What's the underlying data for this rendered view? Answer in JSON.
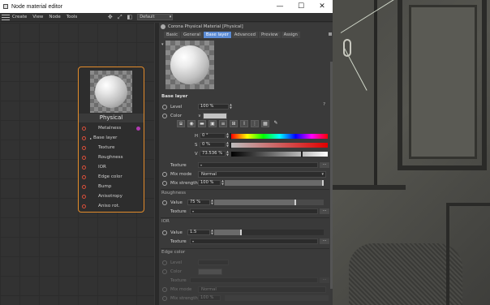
{
  "window": {
    "title": "Node material editor",
    "minimize_glyph": "—",
    "maximize_glyph": "☐",
    "close_glyph": "✕"
  },
  "menubar": {
    "items": [
      "Create",
      "View",
      "Node",
      "Tools"
    ],
    "layout_value": "Default",
    "tool_icons": [
      "move-icon",
      "fit-icon",
      "split-view-icon"
    ]
  },
  "node": {
    "title": "Physical",
    "ports": [
      {
        "label": "Metalness",
        "indent": false,
        "output": true
      },
      {
        "label": "Base layer",
        "indent": false,
        "expander": true
      },
      {
        "label": "Texture",
        "indent": true
      },
      {
        "label": "Roughness",
        "indent": true
      },
      {
        "label": "IOR",
        "indent": true
      },
      {
        "label": "Edge color",
        "indent": true
      },
      {
        "label": "Bump",
        "indent": true
      },
      {
        "label": "Anisotropy",
        "indent": true
      },
      {
        "label": "Aniso rot.",
        "indent": true
      }
    ],
    "accent_color": "#e28b2a",
    "port_color": "#d94f3b",
    "output_port_color": "#b03bb0"
  },
  "attributes": {
    "header": "Corona Physical Material [Physical]",
    "tabs": [
      "Basic",
      "General",
      "Base layer",
      "Advanced",
      "Preview",
      "Assign"
    ],
    "active_tab": "Base layer",
    "active_tab_color": "#5b8bd4",
    "base_layer": {
      "section": "Base layer",
      "help": "?",
      "level_label": "Level",
      "level_value": "100 %",
      "color_label": "Color",
      "color_value": "#c4c4c4",
      "color_icons": [
        "eyedropper-square-icon",
        "color-wheel-icon",
        "spectrum-icon",
        "image-icon",
        "rgb-icon",
        "hsv-icon",
        "kelvin-icon",
        "mixer-icon",
        "swatches-icon",
        "eyedropper-icon"
      ],
      "hsv": {
        "h_label": "H",
        "h_value": "0 °",
        "h_fraction": 0.0,
        "s_label": "S",
        "s_value": "0 %",
        "s_fraction": 0.0,
        "v_label": "V",
        "v_value": "73.536 %",
        "v_fraction": 0.73536
      },
      "texture_label": "Texture",
      "mix_mode_label": "Mix mode",
      "mix_mode_value": "Normal",
      "mix_strength_label": "Mix strength",
      "mix_strength_value": "100 %",
      "mix_strength_fraction": 1.0
    },
    "roughness": {
      "section": "Roughness",
      "value_label": "Value",
      "value": "75 %",
      "fraction": 0.75,
      "texture_label": "Texture"
    },
    "ior": {
      "section": "IOR",
      "value_label": "Value",
      "value": "1.5",
      "fraction": 0.25,
      "texture_label": "Texture"
    },
    "edge_color": {
      "section": "Edge color",
      "level_label": "Level",
      "color_label": "Color",
      "texture_label": "Texture",
      "mix_mode_label": "Mix mode",
      "mix_mode_value": "Normal",
      "mix_strength_label": "Mix strength",
      "mix_strength_value": "100 %"
    },
    "dots_label": "..."
  }
}
